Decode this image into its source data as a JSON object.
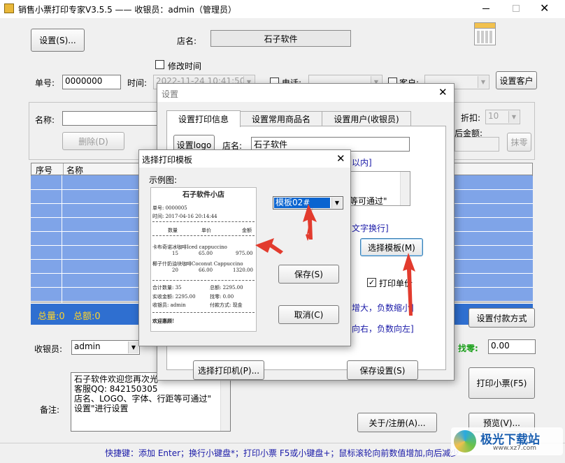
{
  "titlebar": {
    "title": "销售小票打印专家V3.5.5 —— 收银员：admin（管理员）"
  },
  "main": {
    "settings_button": "设置(S)...",
    "store_label": "店名:",
    "store_name": "石子软件",
    "modify_time_label": "修改时间",
    "order_no_label": "单号:",
    "order_no": "0000000",
    "time_label": "时间:",
    "time_value": "2022-11-24 10:41:50",
    "phone_label": "电话:",
    "customer_label": "客户:",
    "set_customer_button": "设置客户",
    "name_label": "名称:",
    "delete_button": "删除(D)",
    "discount_label": "折扣:",
    "discount_value": "10",
    "after_amount_label": "后金额:",
    "erase_button": "抹零",
    "grid_headers": [
      "序号",
      "名称"
    ],
    "totals": "总量:0   总额:0",
    "cashier_label": "收银员:",
    "cashier_value": "admin",
    "notes_label": "备注:",
    "notes_lines": [
      "石子软件欢迎您再次光",
      "客服QQ: 842150305",
      "店名、LOGO、字体、行距等可通过\"",
      "设置\"进行设置"
    ],
    "change_label": "找零:",
    "change_value": "0.00",
    "set_payment_button": "设置付款方式",
    "print_button": "打印小票(F5)",
    "about_button": "关于/注册(A)...",
    "preview_button": "预览(V)...",
    "status_bar": "快捷键：添加 Enter；换行小键盘*；打印小票 F5或小键盘+；鼠标滚轮向前数值增加,向后减少"
  },
  "settings_dialog": {
    "title": "设置",
    "tabs": [
      "设置打印信息",
      "设置常用商品名",
      "设置用户(收银员)"
    ],
    "logo_button": "设置logo",
    "store_label": "店名:",
    "store_value": "石子软件",
    "hint_within": "以内]",
    "hint_pass": "等可通过\"",
    "hint_wrap": "文字换行]",
    "choose_template_button": "选择模板(M)",
    "print_unit_label": "打印单价",
    "hint_bigger": "增大，负数缩小]",
    "hint_right": "向右，负数向左]",
    "choose_printer_button": "选择打印机(P)...",
    "save_settings_button": "保存设置(S)"
  },
  "template_dialog": {
    "title": "选择打印模板",
    "example_label": "示例图:",
    "template_value": "模板02#",
    "save_button": "保存(S)",
    "cancel_button": "取消(C)",
    "receipt": {
      "shop": "石子软件小店",
      "order": "单号: 0000005",
      "time": "时间: 2017-04-16 20:14:44",
      "col_qty": "数量",
      "col_price": "单价",
      "col_amount": "金额",
      "item1_name": "卡布奇诺冰咖啡Iced cappuccino",
      "item1_qty": "15",
      "item1_price": "65.00",
      "item1_amount": "975.00",
      "item2_name": "椰子什奶油块咖啡Coconut Cappuccino",
      "item2_qty": "20",
      "item2_price": "66.00",
      "item2_amount": "1320.00",
      "sum_qty": "合计数量: 35",
      "sum_total": "总额: 2295.00",
      "paid": "实收金额: 2295.00",
      "change": "找零: 0.00",
      "cashier": "收银员: admin",
      "payment": "付款方式: 现金",
      "welcome": "欢迎惠顾!"
    }
  },
  "watermark": {
    "text": "极光下载站",
    "url": "www.xz7.com"
  },
  "colors": {
    "grid_blue": "#7fa4e8",
    "accent_red": "#e23b2e",
    "link_blue": "#1a1aa8"
  }
}
